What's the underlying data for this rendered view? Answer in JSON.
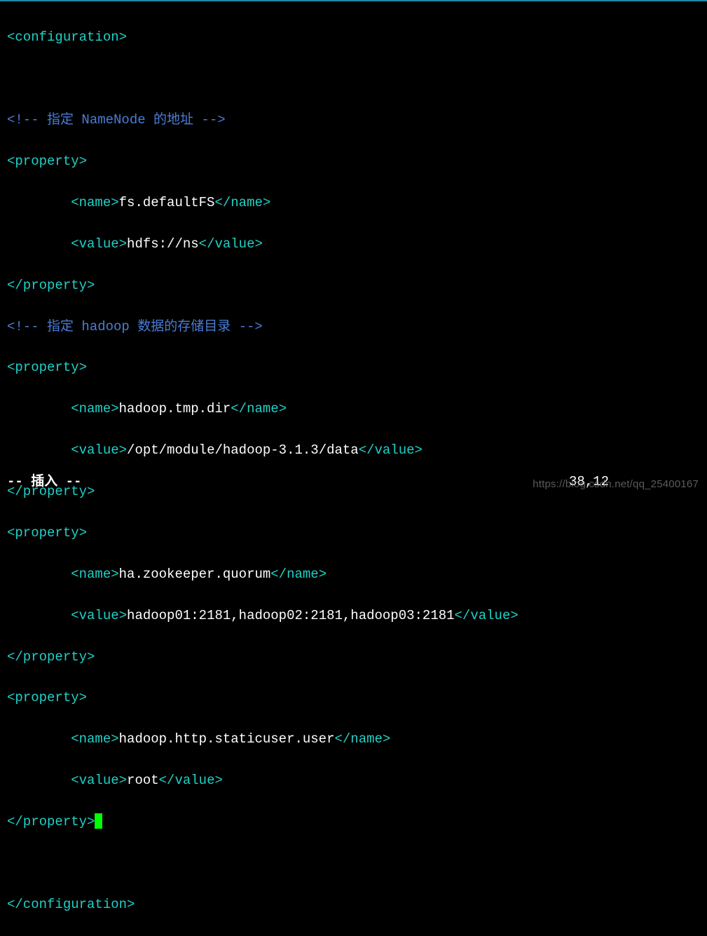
{
  "colors": {
    "bg": "#000000",
    "tag": "#1fd1c7",
    "comment": "#4a7dd6",
    "text": "#ffffff",
    "cursor": "#00ff00"
  },
  "editor_mode": "INSERT",
  "status_text": "-- 插入 --",
  "cursor_pos": {
    "line": "38",
    "col": "12",
    "display": "38,12"
  },
  "watermark": "https://blog.csdn.net/qq_25400167",
  "lines": {
    "l1_open": "<configuration>",
    "blank_a": "",
    "l_comment1": "<!-- 指定 NameNode 的地址 -->",
    "l_prop1_open": "<property>",
    "l_name1_open": "<name>",
    "l_name1_text": "fs.defaultFS",
    "l_name1_close": "</name>",
    "l_value1_open": "<value>",
    "l_value1_text": "hdfs://ns",
    "l_value1_close": "</value>",
    "l_prop1_close": "</property>",
    "l_comment2": "<!-- 指定 hadoop 数据的存储目录 -->",
    "l_prop2_open": "<property>",
    "l_name2_open": "<name>",
    "l_name2_text": "hadoop.tmp.dir",
    "l_name2_close": "</name>",
    "l_value2_open": "<value>",
    "l_value2_text": "/opt/module/hadoop-3.1.3/data",
    "l_value2_close": "</value>",
    "l_prop2_close": "</property>",
    "l_prop3_open": "<property>",
    "l_name3_open": "<name>",
    "l_name3_text": "ha.zookeeper.quorum",
    "l_name3_close": "</name>",
    "l_value3_open": "<value>",
    "l_value3_text": "hadoop01:2181,hadoop02:2181,hadoop03:2181",
    "l_value3_close": "</value>",
    "l_prop3_close": "</property>",
    "l_prop4_open": "<property>",
    "l_name4_open": "<name>",
    "l_name4_text": "hadoop.http.staticuser.user",
    "l_name4_close": "</name>",
    "l_value4_open": "<value>",
    "l_value4_text": "root",
    "l_value4_close": "</value>",
    "l_prop4_close": "</property>",
    "blank_b": "",
    "l_close": "</configuration>"
  }
}
